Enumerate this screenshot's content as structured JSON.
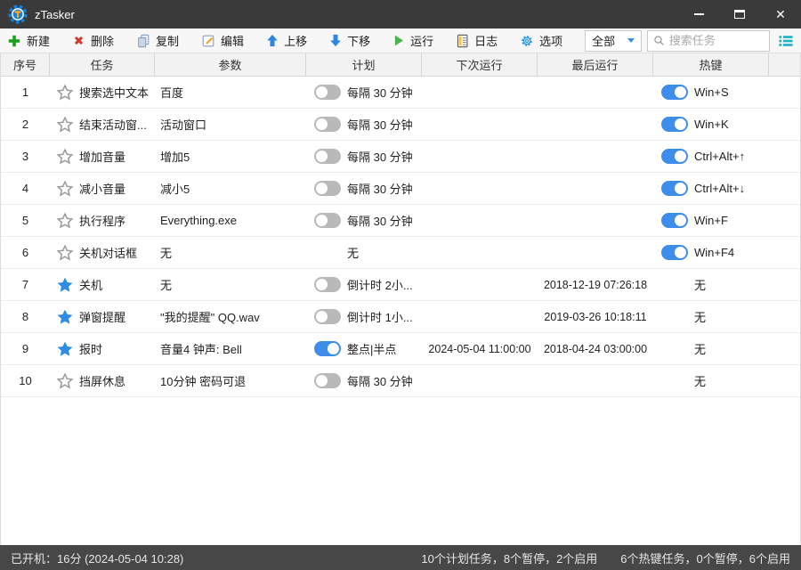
{
  "window": {
    "title": "zTasker"
  },
  "colors": {
    "accent_blue": "#3e8ee9",
    "toggle_off_gray": "#b9b9b9",
    "titlebar_bg": "#3a3a3a",
    "statusbar_bg": "#474747",
    "teal_icon": "#23b2c4",
    "star_blue": "#2f8be4"
  },
  "icons": {
    "app": "gear-badge-with-T",
    "new": "green-plus",
    "delete": "red-x",
    "copy": "two-pages",
    "edit": "pencil-on-page",
    "move_up": "blue-up-arrow",
    "move_down": "blue-down-arrow",
    "run": "green-play-triangle",
    "log": "yellow-clipboard",
    "options": "blue-gear",
    "search": "magnifier",
    "view_list": "teal-list",
    "minimize": "dash",
    "maximize": "square",
    "close": "x"
  },
  "toolbar": {
    "buttons": [
      {
        "label": "新建"
      },
      {
        "label": "删除"
      },
      {
        "label": "复制"
      },
      {
        "label": "编辑"
      },
      {
        "label": "上移"
      },
      {
        "label": "下移"
      },
      {
        "label": "运行"
      },
      {
        "label": "日志"
      },
      {
        "label": "选项"
      }
    ],
    "filter_value": "全部",
    "search_placeholder": "搜索任务"
  },
  "table": {
    "columns": [
      "序号",
      "任务",
      "参数",
      "计划",
      "下次运行",
      "最后运行",
      "热键"
    ],
    "rows": [
      {
        "num": "1",
        "starred": false,
        "task": "搜索选中文本",
        "params": "百度",
        "schedule": {
          "toggle": "off",
          "label": "每隔 30 分钟"
        },
        "next_run": "",
        "last_run": "",
        "hotkey": {
          "toggle": "on",
          "label": "Win+S"
        }
      },
      {
        "num": "2",
        "starred": false,
        "task": "结束活动窗...",
        "params": "活动窗口",
        "schedule": {
          "toggle": "off",
          "label": "每隔 30 分钟"
        },
        "next_run": "",
        "last_run": "",
        "hotkey": {
          "toggle": "on",
          "label": "Win+K"
        }
      },
      {
        "num": "3",
        "starred": false,
        "task": "增加音量",
        "params": "增加5",
        "schedule": {
          "toggle": "off",
          "label": "每隔 30 分钟"
        },
        "next_run": "",
        "last_run": "",
        "hotkey": {
          "toggle": "on",
          "label": "Ctrl+Alt+↑"
        }
      },
      {
        "num": "4",
        "starred": false,
        "task": "减小音量",
        "params": "减小5",
        "schedule": {
          "toggle": "off",
          "label": "每隔 30 分钟"
        },
        "next_run": "",
        "last_run": "",
        "hotkey": {
          "toggle": "on",
          "label": "Ctrl+Alt+↓"
        }
      },
      {
        "num": "5",
        "starred": false,
        "task": "执行程序",
        "params": "Everything.exe",
        "schedule": {
          "toggle": "off",
          "label": "每隔 30 分钟"
        },
        "next_run": "",
        "last_run": "",
        "hotkey": {
          "toggle": "on",
          "label": "Win+F"
        }
      },
      {
        "num": "6",
        "starred": false,
        "task": "关机对话框",
        "params": "无",
        "schedule": {
          "toggle": "none",
          "label": "无"
        },
        "next_run": "",
        "last_run": "",
        "hotkey": {
          "toggle": "on",
          "label": "Win+F4"
        }
      },
      {
        "num": "7",
        "starred": true,
        "task": "关机",
        "params": "无",
        "schedule": {
          "toggle": "off",
          "label": "倒计时 2小..."
        },
        "next_run": "",
        "last_run": "2018-12-19 07:26:18",
        "hotkey": {
          "toggle": "none",
          "label": "无"
        }
      },
      {
        "num": "8",
        "starred": true,
        "task": "弹窗提醒",
        "params": "\"我的提醒\" QQ.wav",
        "schedule": {
          "toggle": "off",
          "label": "倒计时 1小..."
        },
        "next_run": "",
        "last_run": "2019-03-26 10:18:11",
        "hotkey": {
          "toggle": "none",
          "label": "无"
        }
      },
      {
        "num": "9",
        "starred": true,
        "task": "报时",
        "params": "音量4 钟声: Bell",
        "schedule": {
          "toggle": "on",
          "label": "整点|半点"
        },
        "next_run": "2024-05-04 11:00:00",
        "last_run": "2018-04-24 03:00:00",
        "hotkey": {
          "toggle": "none",
          "label": "无"
        }
      },
      {
        "num": "10",
        "starred": false,
        "task": "挡屏休息",
        "params": "10分钟 密码可退",
        "schedule": {
          "toggle": "off",
          "label": "每隔 30 分钟"
        },
        "next_run": "",
        "last_run": "",
        "hotkey": {
          "toggle": "none",
          "label": "无"
        }
      }
    ]
  },
  "statusbar": {
    "uptime": "已开机：16分 (2024-05-04 10:28)",
    "schedule_summary": "10个计划任务，8个暂停，2个启用",
    "hotkey_summary": "6个热键任务，0个暂停，6个启用"
  }
}
